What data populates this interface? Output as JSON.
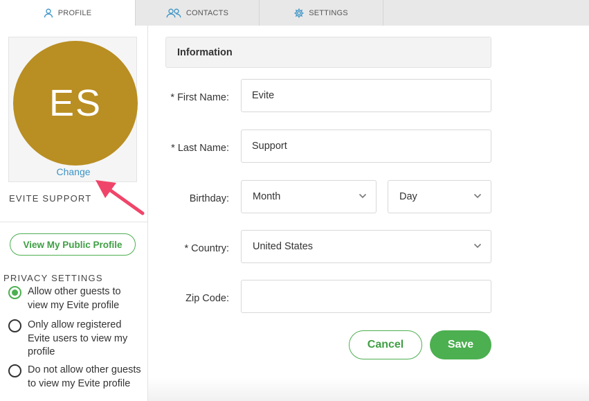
{
  "tabs": [
    {
      "label": "PROFILE",
      "icon": "user-icon",
      "active": true
    },
    {
      "label": "CONTACTS",
      "icon": "users-icon",
      "active": false
    },
    {
      "label": "SETTINGS",
      "icon": "gear-icon",
      "active": false
    }
  ],
  "sidebar": {
    "avatar_initials": "ES",
    "avatar_color": "#b98e22",
    "change_label": "Change",
    "display_name": "EVITE SUPPORT",
    "public_profile_button": "View My Public Profile",
    "privacy_title": "PRIVACY SETTINGS",
    "privacy_options": [
      {
        "label": "Allow other guests to view my Evite profile",
        "selected": true
      },
      {
        "label": "Only allow registered Evite users to view my profile",
        "selected": false
      },
      {
        "label": "Do not allow other guests to view my Evite profile",
        "selected": false
      }
    ]
  },
  "form": {
    "section_title": "Information",
    "first_name_label": "* First Name:",
    "first_name_value": "Evite",
    "last_name_label": "* Last Name:",
    "last_name_value": "Support",
    "birthday_label": "Birthday:",
    "birthday_month": "Month",
    "birthday_day": "Day",
    "country_label": "* Country:",
    "country_value": "United States",
    "zip_label": "Zip Code:",
    "zip_value": "",
    "cancel_label": "Cancel",
    "save_label": "Save"
  },
  "colors": {
    "accent_green": "#4caf50",
    "link_blue": "#3a93c6",
    "annotation_arrow": "#f0456a"
  }
}
